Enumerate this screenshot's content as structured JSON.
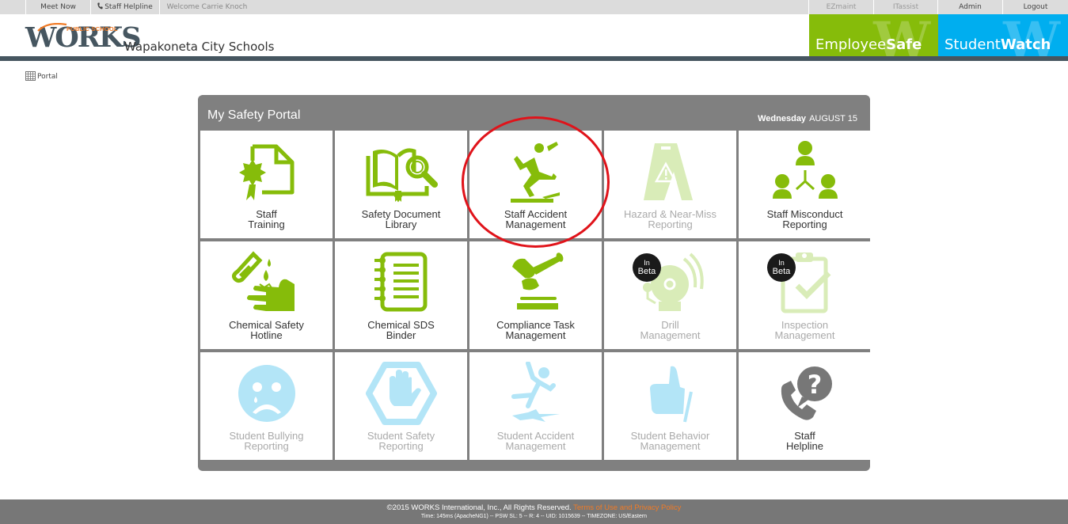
{
  "topbar": {
    "meet_now": "Meet Now",
    "staff_helpline": "Staff Helpline",
    "welcome": "Welcome Carrie Knoch",
    "ezmaint": "EZmaint",
    "itassist": "ITassist",
    "admin": "Admin",
    "logout": "Logout"
  },
  "header": {
    "logo_works": "WORKS",
    "logo_public_school": "PUBLIC SCHOOL",
    "district_name": "Wapakoneta City Schools",
    "employee_brand_regular": "Employee",
    "employee_brand_bold": "Safe",
    "student_brand_regular": "Student",
    "student_brand_bold": "Watch",
    "colors": {
      "employee": "#86bc0a",
      "student": "#00aeef",
      "dark_bar": "#465660",
      "accent_orange": "#f07a25"
    }
  },
  "breadcrumb": {
    "icon": "grid-icon",
    "label": "Portal"
  },
  "portal": {
    "title": "My Safety Portal",
    "date_weekday": "Wednesday",
    "date_day": "AUGUST 15",
    "tiles": [
      {
        "line1": "Staff",
        "line2": "Training",
        "icon": "certificate-icon",
        "state": "enabled"
      },
      {
        "line1": "Safety Document",
        "line2": "Library",
        "icon": "book-magnifier-icon",
        "state": "enabled"
      },
      {
        "line1": "Staff Accident",
        "line2": "Management",
        "icon": "person-slipping-icon",
        "state": "enabled",
        "highlighted": true
      },
      {
        "line1": "Hazard & Near-Miss",
        "line2": "Reporting",
        "icon": "wet-floor-sign-icon",
        "state": "disabled"
      },
      {
        "line1": "Staff Misconduct",
        "line2": "Reporting",
        "icon": "people-network-icon",
        "state": "enabled"
      },
      {
        "line1": "Chemical Safety",
        "line2": "Hotline",
        "icon": "chemical-hand-icon",
        "state": "enabled"
      },
      {
        "line1": "Chemical SDS",
        "line2": "Binder",
        "icon": "spiral-binder-icon",
        "state": "enabled"
      },
      {
        "line1": "Compliance Task",
        "line2": "Management",
        "icon": "gavel-icon",
        "state": "enabled"
      },
      {
        "line1": "Drill",
        "line2": "Management",
        "icon": "alarm-bell-icon",
        "state": "disabled",
        "badge": [
          "In",
          "Beta"
        ]
      },
      {
        "line1": "Inspection",
        "line2": "Management",
        "icon": "clipboard-check-icon",
        "state": "disabled",
        "badge": [
          "In",
          "Beta"
        ]
      },
      {
        "line1": "Student Bullying",
        "line2": "Reporting",
        "icon": "sad-face-icon",
        "state": "disabled"
      },
      {
        "line1": "Student Safety",
        "line2": "Reporting",
        "icon": "stop-hand-icon",
        "state": "disabled"
      },
      {
        "line1": "Student Accident",
        "line2": "Management",
        "icon": "student-falling-icon",
        "state": "disabled"
      },
      {
        "line1": "Student Behavior",
        "line2": "Management",
        "icon": "thumbs-up-icon",
        "state": "disabled"
      },
      {
        "line1": "Staff",
        "line2": "Helpline",
        "icon": "phone-question-icon",
        "state": "enabled"
      }
    ]
  },
  "footer": {
    "copyright": "©2015 WORKS International, Inc., All Rights Reserved.",
    "terms_link": "Terms of Use and Privacy Policy",
    "debug": "Time: 145ms (ApacheNG1) -- PSW SL: 5 -- R: 4 -- UID: 1015639 -- TIMEZONE: US/Eastern"
  }
}
